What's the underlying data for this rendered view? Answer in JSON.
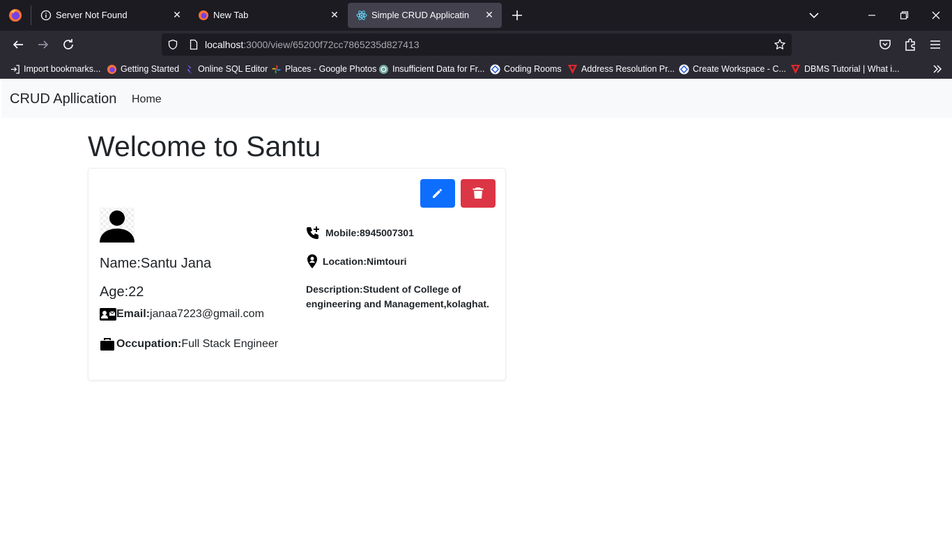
{
  "browser": {
    "tabs": [
      {
        "title": "Server Not Found",
        "icon": "info-icon",
        "active": false
      },
      {
        "title": "New Tab",
        "icon": "firefox-icon",
        "active": false
      },
      {
        "title": "Simple CRUD Applicatin",
        "icon": "react-icon",
        "active": true
      }
    ],
    "url_host": "localhost",
    "url_path": ":3000/view/65200f72cc7865235d827413",
    "bookmarks": [
      {
        "label": "Import bookmarks...",
        "icon": "import-icon"
      },
      {
        "label": "Getting Started",
        "icon": "firefox-icon"
      },
      {
        "label": "Online SQL Editor",
        "icon": "sql-icon"
      },
      {
        "label": "Places - Google Photos",
        "icon": "photos-icon"
      },
      {
        "label": "Insufficient Data for Fr...",
        "icon": "openai-icon"
      },
      {
        "label": "Coding Rooms",
        "icon": "coding-rooms-icon"
      },
      {
        "label": "Address Resolution Pr...",
        "icon": "v-icon"
      },
      {
        "label": "Create Workspace - C...",
        "icon": "coding-rooms-icon"
      },
      {
        "label": "DBMS Tutorial | What i...",
        "icon": "v-icon"
      }
    ]
  },
  "app": {
    "brand": "CRUD Apllication",
    "nav_home": "Home",
    "welcome": "Welcome to Santu"
  },
  "profile": {
    "name_label": "Name:",
    "name": "Santu Jana",
    "age_label": "Age:",
    "age": "22",
    "email_label": "Email:",
    "email": "janaa7223@gmail.com",
    "occupation_label": "Occupation:",
    "occupation": "Full Stack Engineer",
    "mobile_label": "Mobile:",
    "mobile": "8945007301",
    "location_label": "Location:",
    "location": "Nimtouri",
    "description_label": "Description:",
    "description": "Student of College of engineering and Management,kolaghat."
  },
  "colors": {
    "edit_button": "#0d6efd",
    "delete_button": "#dc3545"
  }
}
